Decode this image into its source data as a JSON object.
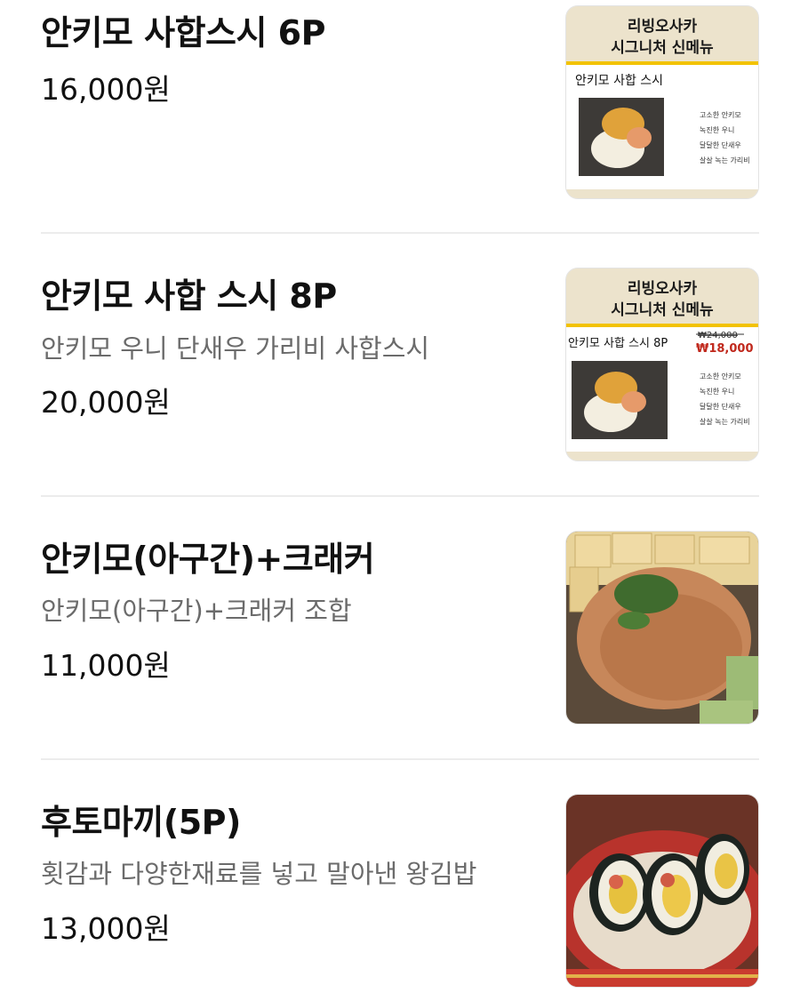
{
  "menu": {
    "items": [
      {
        "name": "안키모 사합스시 6P",
        "description": "",
        "price": "16,000원",
        "image": {
          "type": "poster",
          "headline1": "리빙오사카",
          "headline2": "시그니처 신메뉴",
          "subtitle": "안키모 사합 스시",
          "notes": [
            "고소한 안키모",
            "녹진한 우니",
            "달달한 단새우",
            "살살 녹는 가리비"
          ]
        }
      },
      {
        "name": "안키모 사합 스시 8P",
        "description": "안키모 우니 단새우 가리비 사합스시",
        "price": "20,000원",
        "image": {
          "type": "poster",
          "headline1": "리빙오사카",
          "headline2": "시그니처 신메뉴",
          "subtitle": "안키모 사합 스시 8P",
          "old_price": "₩24,000",
          "new_price": "₩18,000",
          "notes": [
            "고소한 안키모",
            "녹진한 우니",
            "달달한 단새우",
            "살살 녹는 가리비"
          ]
        }
      },
      {
        "name": "안키모(아구간)+크래커",
        "description": "안키모(아구간)+크래커 조합",
        "price": "11,000원",
        "image": {
          "type": "photo",
          "icon": "ankimo-crackers-photo"
        }
      },
      {
        "name": "후토마끼(5P)",
        "description": "횟감과 다양한재료를 넣고 말아낸 왕김밥",
        "price": "13,000원",
        "image": {
          "type": "photo",
          "icon": "futomaki-photo"
        }
      }
    ]
  },
  "colors": {
    "text": "#111111",
    "muted": "#6b6b6b",
    "divider": "#ececec",
    "sale_red": "#c0281c"
  }
}
